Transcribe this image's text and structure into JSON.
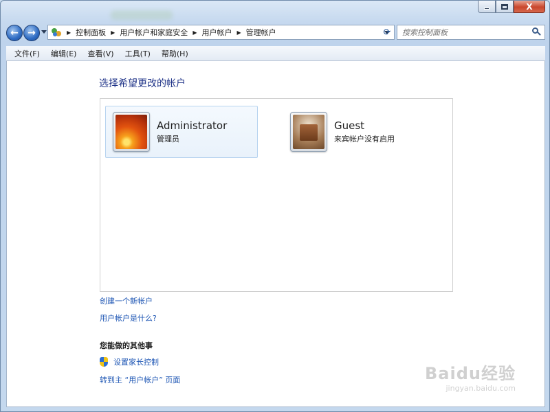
{
  "window": {
    "controls": {
      "minimize": "",
      "maximize": "",
      "close": "X"
    }
  },
  "nav": {
    "back_glyph": "←",
    "forward_glyph": "→",
    "breadcrumbs": [
      "控制面板",
      "用户帐户和家庭安全",
      "用户帐户",
      "管理帐户"
    ],
    "refresh_glyph": "⟳",
    "search_placeholder": "搜索控制面板"
  },
  "menubar": [
    {
      "label": "文件(F)"
    },
    {
      "label": "编辑(E)"
    },
    {
      "label": "查看(V)"
    },
    {
      "label": "工具(T)"
    },
    {
      "label": "帮助(H)"
    }
  ],
  "main": {
    "title": "选择希望更改的帐户",
    "accounts": [
      {
        "name": "Administrator",
        "subtitle": "管理员",
        "avatar": "flower-avatar"
      },
      {
        "name": "Guest",
        "subtitle": "来宾帐户没有启用",
        "avatar": "briefcase-avatar"
      }
    ],
    "links": {
      "create": "创建一个新帐户",
      "what_is": "用户帐户是什么?"
    },
    "other_tasks": {
      "title": "您能做的其他事",
      "parental_control": "设置家长控制",
      "goto_main": "转到主 “用户帐户” 页面"
    }
  },
  "watermark": {
    "main": "Baidu经验",
    "sub": "jingyan.baidu.com"
  },
  "colors": {
    "link": "#1e56b4",
    "title": "#1e3287",
    "close_button": "#c9462c"
  }
}
